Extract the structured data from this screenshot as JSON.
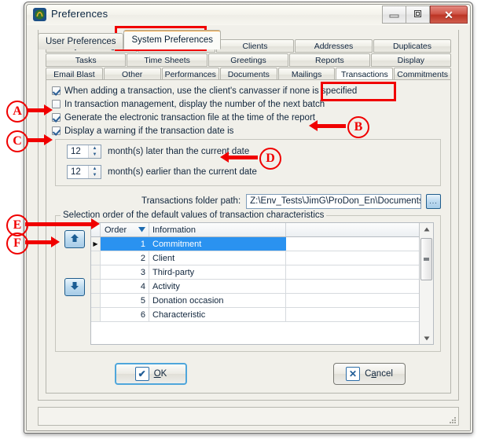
{
  "window": {
    "title": "Preferences",
    "icon": "app-logo-icon",
    "buttons": {
      "minimize": "–",
      "maximize": "□",
      "close": "✕"
    }
  },
  "outer_tabs": [
    {
      "label": "User Preferences",
      "active": false
    },
    {
      "label": "System Preferences",
      "active": true
    }
  ],
  "inner_tabs": {
    "row1": [
      {
        "label": "Security and Language",
        "active": false
      },
      {
        "label": "Regional Options",
        "active": false
      },
      {
        "label": "Clients",
        "active": false
      },
      {
        "label": "Addresses",
        "active": false
      },
      {
        "label": "Duplicates",
        "active": false
      }
    ],
    "row2": [
      {
        "label": "Tasks",
        "active": false
      },
      {
        "label": "Time Sheets",
        "active": false
      },
      {
        "label": "Greetings",
        "active": false
      },
      {
        "label": "Reports",
        "active": false
      },
      {
        "label": "Display",
        "active": false
      }
    ],
    "row3": [
      {
        "label": "Email Blast",
        "active": false
      },
      {
        "label": "Other",
        "active": false
      },
      {
        "label": "Performances",
        "active": false
      },
      {
        "label": "Documents",
        "active": false
      },
      {
        "label": "Mailings",
        "active": false
      },
      {
        "label": "Transactions",
        "active": true
      },
      {
        "label": "Commitments",
        "active": false
      }
    ]
  },
  "checkboxes": [
    {
      "label": "When adding a transaction, use the client's canvasser if none is specified",
      "checked": true
    },
    {
      "label": "In transaction management, display the number of the next batch",
      "checked": false
    },
    {
      "label": "Generate the electronic transaction file at the time of the report",
      "checked": true
    },
    {
      "label": "Display a warning if the transaction date is",
      "checked": true
    }
  ],
  "spinners": [
    {
      "value": "12",
      "label": "month(s) later than the current date"
    },
    {
      "value": "12",
      "label": "month(s) earlier than the current date"
    }
  ],
  "folder_path": {
    "label": "Transactions folder path:",
    "value": "Z:\\Env_Tests\\JimG\\ProDon_En\\Documents\\Transaction\\",
    "browse_label": "..."
  },
  "grid": {
    "legend": "Selection order of the default values of transaction characteristics",
    "columns": [
      "Order",
      "Information"
    ],
    "sort_column": "Order",
    "sort_direction": "descending",
    "rows": [
      {
        "order": "1",
        "information": "Commitment",
        "selected": true
      },
      {
        "order": "2",
        "information": "Client",
        "selected": false
      },
      {
        "order": "3",
        "information": "Third-party",
        "selected": false
      },
      {
        "order": "4",
        "information": "Activity",
        "selected": false
      },
      {
        "order": "5",
        "information": "Donation occasion",
        "selected": false
      },
      {
        "order": "6",
        "information": "Characteristic",
        "selected": false
      }
    ],
    "move_up_label": "⬆",
    "move_down_label": "⬇",
    "scroll_up_label": "▲",
    "scroll_down_label": "▼"
  },
  "footer": {
    "ok_icon": "✔",
    "ok_prefix": "O",
    "ok_suffix": "K",
    "cancel_icon": "✕",
    "cancel_prefix": "C",
    "cancel_mid": "a",
    "cancel_suffix": "ncel"
  },
  "annotations": [
    {
      "id": "A",
      "letter": "A"
    },
    {
      "id": "B",
      "letter": "B"
    },
    {
      "id": "C",
      "letter": "C"
    },
    {
      "id": "D",
      "letter": "D"
    },
    {
      "id": "E",
      "letter": "E"
    },
    {
      "id": "F",
      "letter": "F"
    }
  ],
  "colors": {
    "annotation_red": "#f00000",
    "selection_blue": "#2a92f0",
    "active_tab_accent": "#f2a33c",
    "focus_border": "#4fa6db"
  }
}
